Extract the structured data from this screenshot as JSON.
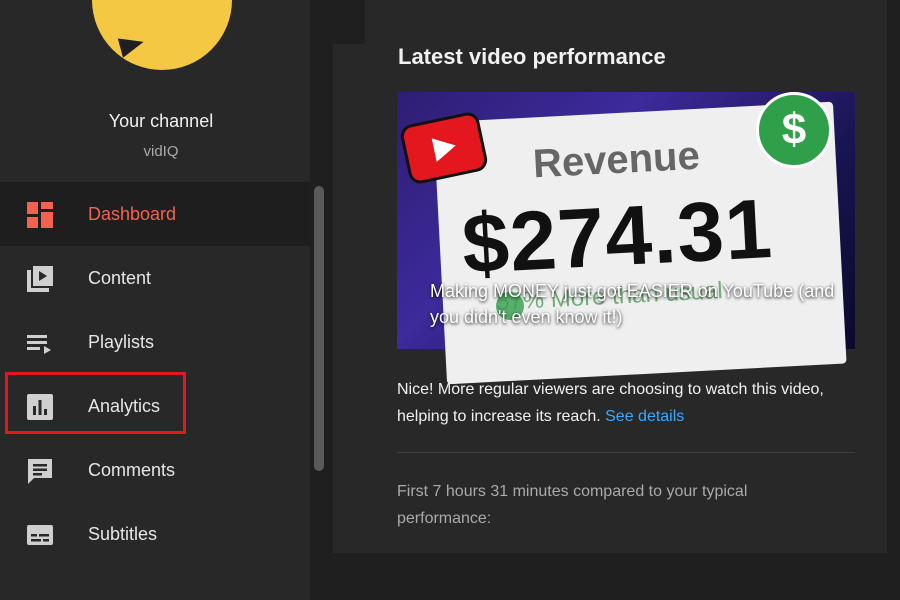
{
  "channel": {
    "title": "Your channel",
    "subtitle": "vidIQ"
  },
  "sidebar": {
    "items": [
      {
        "label": "Dashboard",
        "icon": "dashboard-icon",
        "active": true
      },
      {
        "label": "Content",
        "icon": "content-icon",
        "active": false
      },
      {
        "label": "Playlists",
        "icon": "playlists-icon",
        "active": false
      },
      {
        "label": "Analytics",
        "icon": "analytics-icon",
        "active": false
      },
      {
        "label": "Comments",
        "icon": "comments-icon",
        "active": false
      },
      {
        "label": "Subtitles",
        "icon": "subtitles-icon",
        "active": false
      }
    ]
  },
  "main": {
    "section_title": "Latest video performance",
    "video": {
      "title": "Making MONEY just got EASIER on YouTube (and you didn't even know it!)",
      "thumbnail": {
        "heading": "Revenue",
        "amount": "$274.31",
        "badge": "$",
        "subtext": "57% More than usual"
      }
    },
    "insight_text": "Nice! More regular viewers are choosing to watch this video, helping to increase its reach.",
    "insight_link": "See details",
    "comparison_text": "First 7 hours 31 minutes compared to your typical performance:"
  },
  "colors": {
    "accent_active": "#f2634f",
    "link": "#3ea6ff",
    "highlight_box": "#e3171d",
    "avatar": "#f4c842"
  }
}
